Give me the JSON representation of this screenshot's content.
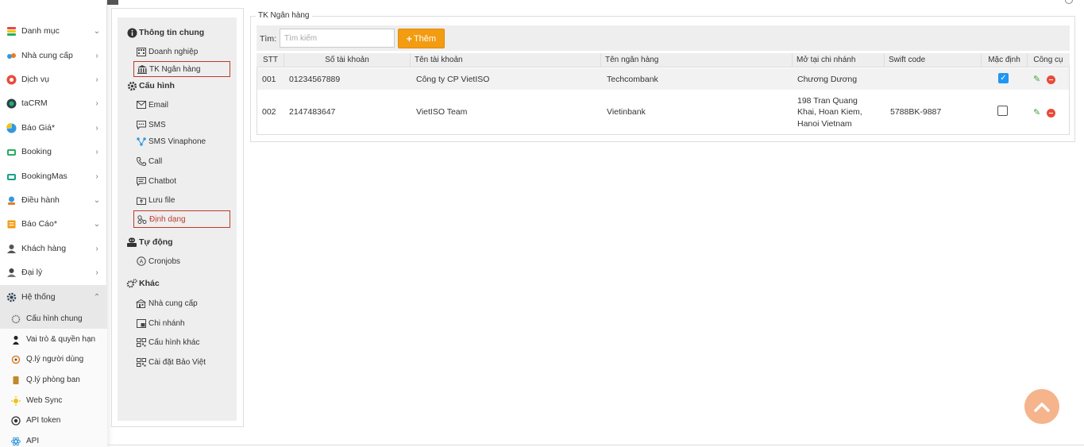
{
  "sidebar": {
    "items": [
      {
        "label": "Danh mục",
        "icon": "layers-icon",
        "chevron": "⌄"
      },
      {
        "label": "Nhà cung cấp",
        "icon": "supplier-icon",
        "chevron": "›"
      },
      {
        "label": "Dịch vụ",
        "icon": "service-icon",
        "chevron": "›"
      },
      {
        "label": "taCRM",
        "icon": "crm-icon",
        "chevron": "›"
      },
      {
        "label": "Báo Giá*",
        "icon": "quote-icon",
        "chevron": "›"
      },
      {
        "label": "Booking",
        "icon": "booking-icon",
        "chevron": "›"
      },
      {
        "label": "BookingMas",
        "icon": "booking-mas-icon",
        "chevron": "›"
      },
      {
        "label": "Điều hành",
        "icon": "operation-icon",
        "chevron": "⌄"
      },
      {
        "label": "Báo Cáo*",
        "icon": "report-icon",
        "chevron": "⌄"
      },
      {
        "label": "Khách hàng",
        "icon": "customer-icon",
        "chevron": "›"
      },
      {
        "label": "Đại lý",
        "icon": "agent-icon",
        "chevron": "›"
      },
      {
        "label": "Hệ thống",
        "icon": "gear-icon",
        "chevron": "⌃"
      }
    ],
    "subitems": [
      {
        "label": "Cấu hình chung",
        "icon": "settings-icon"
      },
      {
        "label": "Vai trò & quyền hạn",
        "icon": "role-icon"
      },
      {
        "label": "Q.lý người dùng",
        "icon": "users-icon"
      },
      {
        "label": "Q.lý phòng ban",
        "icon": "department-icon"
      },
      {
        "label": "Web Sync",
        "icon": "sync-icon"
      },
      {
        "label": "API token",
        "icon": "token-icon"
      },
      {
        "label": "API",
        "icon": "api-icon"
      }
    ]
  },
  "config": {
    "sections": [
      {
        "title": "Thông tin chung",
        "icon": "info-icon",
        "items": [
          {
            "label": "Doanh nghiệp",
            "icon": "building-icon"
          },
          {
            "label": "TK Ngân hàng",
            "icon": "bank-icon"
          }
        ]
      },
      {
        "title": "Cấu hình",
        "icon": "cog-icon",
        "items": [
          {
            "label": "Email",
            "icon": "email-icon"
          },
          {
            "label": "SMS",
            "icon": "sms-icon"
          },
          {
            "label": "SMS Vinaphone",
            "icon": "share-icon"
          },
          {
            "label": "Call",
            "icon": "phone-icon"
          },
          {
            "label": "Chatbot",
            "icon": "chat-icon"
          },
          {
            "label": "Lưu file",
            "icon": "upload-icon"
          },
          {
            "label": "Định dạng",
            "icon": "format-icon"
          }
        ]
      },
      {
        "title": "Tự động",
        "icon": "robot-icon",
        "items": [
          {
            "label": "Cronjobs",
            "icon": "cron-icon"
          }
        ]
      },
      {
        "title": "Khác",
        "icon": "cogs-icon",
        "items": [
          {
            "label": "Nhà cung cấp",
            "icon": "store-icon"
          },
          {
            "label": "Chi nhánh",
            "icon": "branch-icon"
          },
          {
            "label": "Cấu hình khác",
            "icon": "grid-icon"
          },
          {
            "label": "Cài đặt Bảo Việt",
            "icon": "grid-icon"
          }
        ]
      }
    ]
  },
  "main": {
    "legend": "TK Ngân hàng",
    "search_label": "Tìm:",
    "search_placeholder": "Tìm kiếm",
    "add_label": "Thêm",
    "columns": [
      "STT",
      "Số tài khoản",
      "Tên tài khoản",
      "Tên ngân hàng",
      "Mở tại chi nhánh",
      "Swift code",
      "Mặc định",
      "Công cụ"
    ],
    "rows": [
      {
        "stt": "001",
        "account_no": "01234567889",
        "account_name": "Công ty CP VietISO",
        "bank": "Techcombank",
        "branch": [
          "Chương Dương"
        ],
        "swift": "",
        "default": true
      },
      {
        "stt": "002",
        "account_no": "2147483647",
        "account_name": "VietISO Team",
        "bank": "Vietinbank",
        "branch": [
          "198 Tran Quang",
          "Khai, Hoan Kiem,",
          "Hanoi Vietnam"
        ],
        "swift": "5788BK-9887",
        "default": false
      }
    ]
  },
  "colors": {
    "accent": "#f39c12",
    "active_border": "#c0392b",
    "checkbox": "#2196f3",
    "scroll_button": "#f5b48b"
  }
}
